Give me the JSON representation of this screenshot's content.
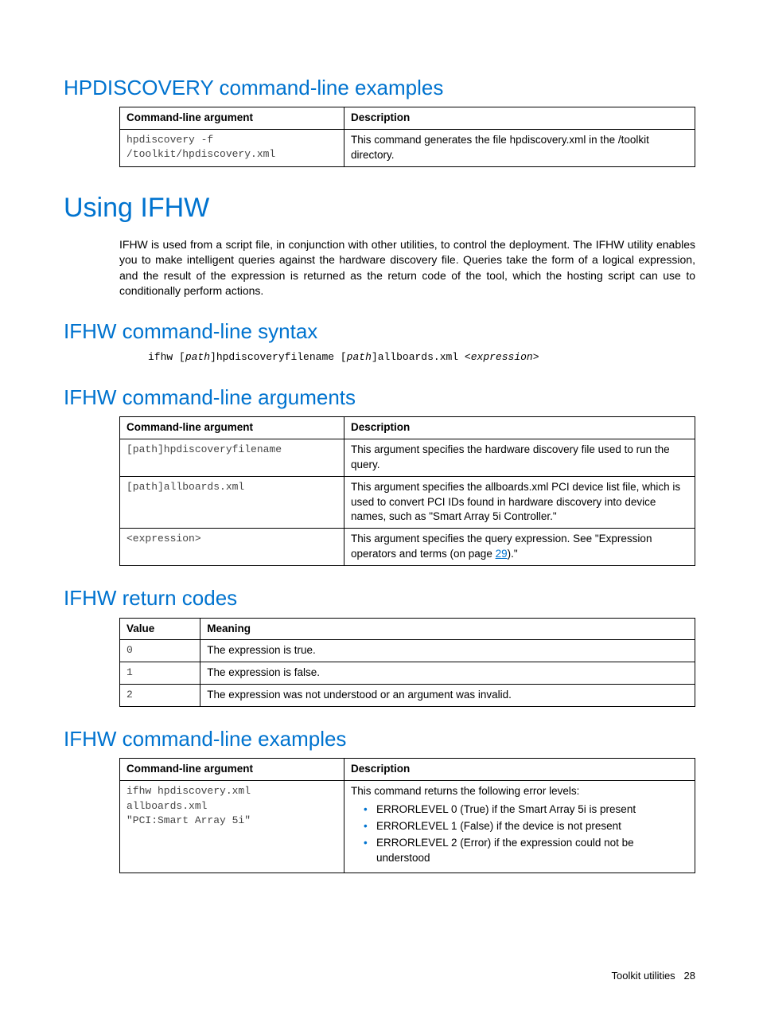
{
  "sec1": {
    "heading": "HPDISCOVERY command-line examples",
    "th1": "Command-line argument",
    "th2": "Description",
    "r1c1a": "hpdiscovery -f",
    "r1c1b": "/toolkit/hpdiscovery.xml",
    "r1c2": "This command generates the file hpdiscovery.xml in the /toolkit directory."
  },
  "sec2": {
    "heading": "Using IFHW",
    "para": "IFHW is used from a script file, in conjunction with other utilities, to control the deployment. The IFHW utility enables you to make intelligent queries against the hardware discovery file. Queries take the form of a logical expression, and the result of the expression is returned as the return code of the tool, which the hosting script can use to conditionally perform actions."
  },
  "sec3": {
    "heading": "IFHW command-line syntax",
    "syntax_pre": "ifhw [",
    "syntax_p1": "path",
    "syntax_mid1": "]hpdiscoveryfilename [",
    "syntax_p2": "path",
    "syntax_mid2": "]allboards.xml <",
    "syntax_expr": "expression",
    "syntax_end": ">"
  },
  "sec4": {
    "heading": "IFHW command-line arguments",
    "th1": "Command-line argument",
    "th2": "Description",
    "r1c1": "[path]hpdiscoveryfilename",
    "r1c2": "This argument specifies the hardware discovery file used to run the query.",
    "r2c1": "[path]allboards.xml",
    "r2c2": "This argument specifies the allboards.xml PCI device list file, which is used to convert PCI IDs found in hardware discovery into device names, such as \"Smart Array 5i Controller.\"",
    "r3c1": "<expression>",
    "r3c2a": "This argument specifies the query expression. See \"Expression operators and terms (on page ",
    "r3c2_link": "29",
    "r3c2b": ").\""
  },
  "sec5": {
    "heading": "IFHW return codes",
    "th1": "Value",
    "th2": "Meaning",
    "r1c1": "0",
    "r1c2": "The expression is true.",
    "r2c1": "1",
    "r2c2": "The expression is false.",
    "r3c1": "2",
    "r3c2": "The expression was not understood or an argument was invalid."
  },
  "sec6": {
    "heading": "IFHW command-line examples",
    "th1": "Command-line argument",
    "th2": "Description",
    "r1c1a": "ifhw hpdiscovery.xml allboards.xml",
    "r1c1b": "\"PCI:Smart Array 5i\"",
    "r1c2_intro": "This command returns the following error levels:",
    "b1": "ERRORLEVEL 0 (True) if the Smart Array 5i is present",
    "b2": "ERRORLEVEL 1 (False) if the device is not present",
    "b3": "ERRORLEVEL 2 (Error) if the expression could not be understood"
  },
  "footer": {
    "label": "Toolkit utilities",
    "page": "28"
  }
}
